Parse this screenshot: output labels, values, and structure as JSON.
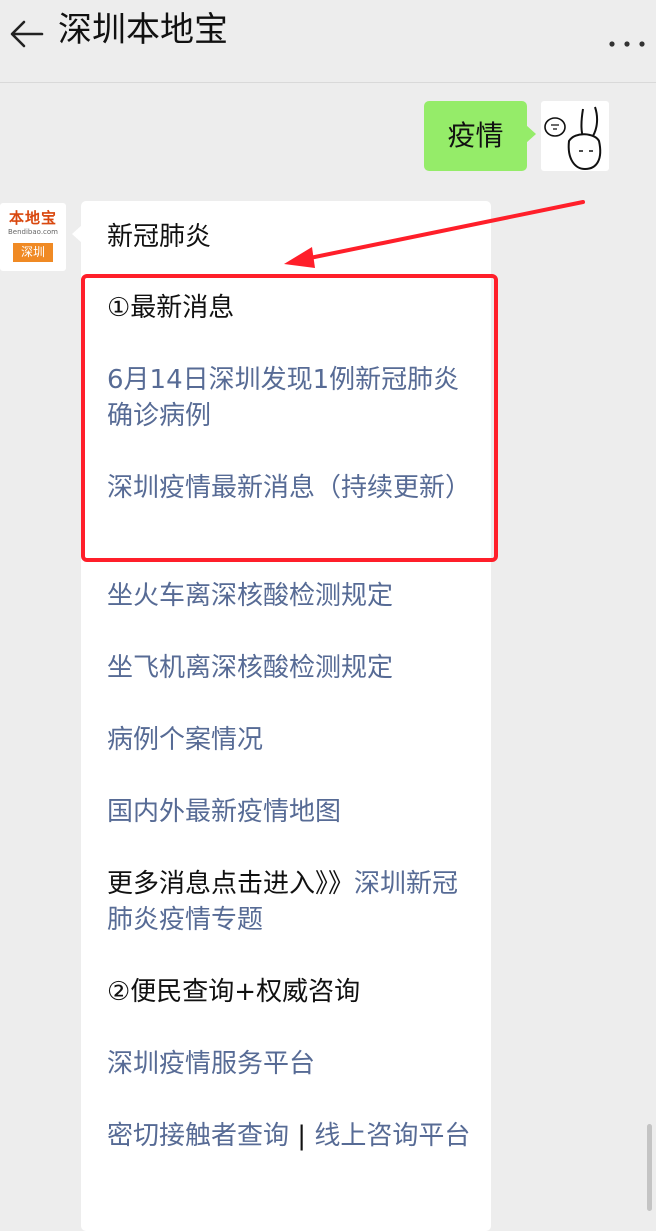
{
  "header": {
    "title": "深圳本地宝"
  },
  "chat": {
    "user_message": "疫情",
    "bot_logo": {
      "name": "本地宝",
      "domain": "Bendibao.com",
      "city_tag": "深圳"
    },
    "bot_card": {
      "heading": "新冠肺炎",
      "section1": "①最新消息",
      "link1": "6月14日深圳发现1例新冠肺炎确诊病例",
      "link2": "深圳疫情最新消息（持续更新）",
      "link3": "坐火车离深核酸检测规定",
      "link4": "坐飞机离深核酸检测规定",
      "link5": "病例个案情况",
      "link6": "国内外最新疫情地图",
      "more_prefix": "更多消息点击进入》》",
      "more_link": "深圳新冠肺炎疫情专题",
      "section2": "②便民查询+权威咨询",
      "link7": "深圳疫情服务平台",
      "link8a": "密切接触者查询",
      "separator": " | ",
      "link8b": "线上咨询平台"
    }
  },
  "colors": {
    "background": "#ededed",
    "user_bubble": "#95ec69",
    "link": "#576b95",
    "highlight": "#ff1f2a",
    "logo_orange": "#f08a24"
  },
  "icons": {
    "back": "back-arrow-icon",
    "more": "more-dots-icon",
    "avatar": "rabbit-sticker-icon"
  }
}
